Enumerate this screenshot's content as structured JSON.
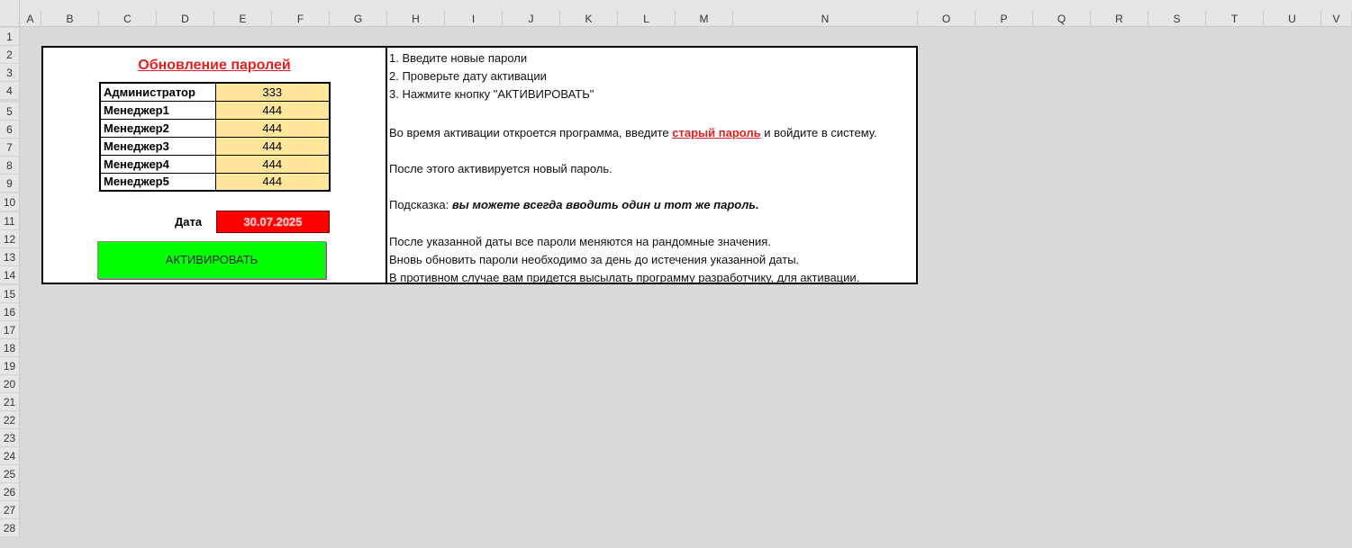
{
  "columns": [
    "A",
    "B",
    "C",
    "D",
    "E",
    "F",
    "G",
    "H",
    "I",
    "J",
    "K",
    "L",
    "M",
    "N",
    "O",
    "P",
    "Q",
    "R",
    "S",
    "T",
    "U",
    "V"
  ],
  "rows": [
    "1",
    "2",
    "3",
    "4",
    "5",
    "6",
    "7",
    "8",
    "9",
    "10",
    "11",
    "12",
    "13",
    "14",
    "15",
    "16",
    "17",
    "18",
    "19",
    "20",
    "21",
    "22",
    "23",
    "24",
    "25",
    "26",
    "27",
    "28"
  ],
  "form": {
    "title": "Обновление паролей",
    "users": [
      {
        "name": "Администратор",
        "password": "333"
      },
      {
        "name": "Менеджер1",
        "password": "444"
      },
      {
        "name": "Менеджер2",
        "password": "444"
      },
      {
        "name": "Менеджер3",
        "password": "444"
      },
      {
        "name": "Менеджер4",
        "password": "444"
      },
      {
        "name": "Менеджер5",
        "password": "444"
      }
    ],
    "date_label": "Дата",
    "date_value": "30.07.2025",
    "activate_label": "АКТИВИРОВАТЬ"
  },
  "instructions": {
    "step1": "1. Введите новые пароли",
    "step2": "2. Проверьте дату активации",
    "step3": "3. Нажмите кнопку \"АКТИВИРОВАТЬ\"",
    "activation_pre": "Во время активации откроется программа, введите ",
    "activation_highlight": "старый пароль",
    "activation_post": " и войдите в систему.",
    "after": "После этого активируется новый пароль.",
    "hint_prefix": "Подсказка: ",
    "hint_text": "вы можете всегда вводить один и тот же пароль.",
    "expiry1": "После указанной даты все пароли меняются на рандомные значения.",
    "expiry2": "Вновь обновить пароли необходимо за день до истечения указанной даты.",
    "expiry3": "В противном случае вам придется высылать программу разработчику, для активации."
  },
  "colors": {
    "title_red": "#e32020",
    "password_fill": "#ffe699",
    "date_fill": "#ff0000",
    "button_fill": "#00ff00"
  }
}
